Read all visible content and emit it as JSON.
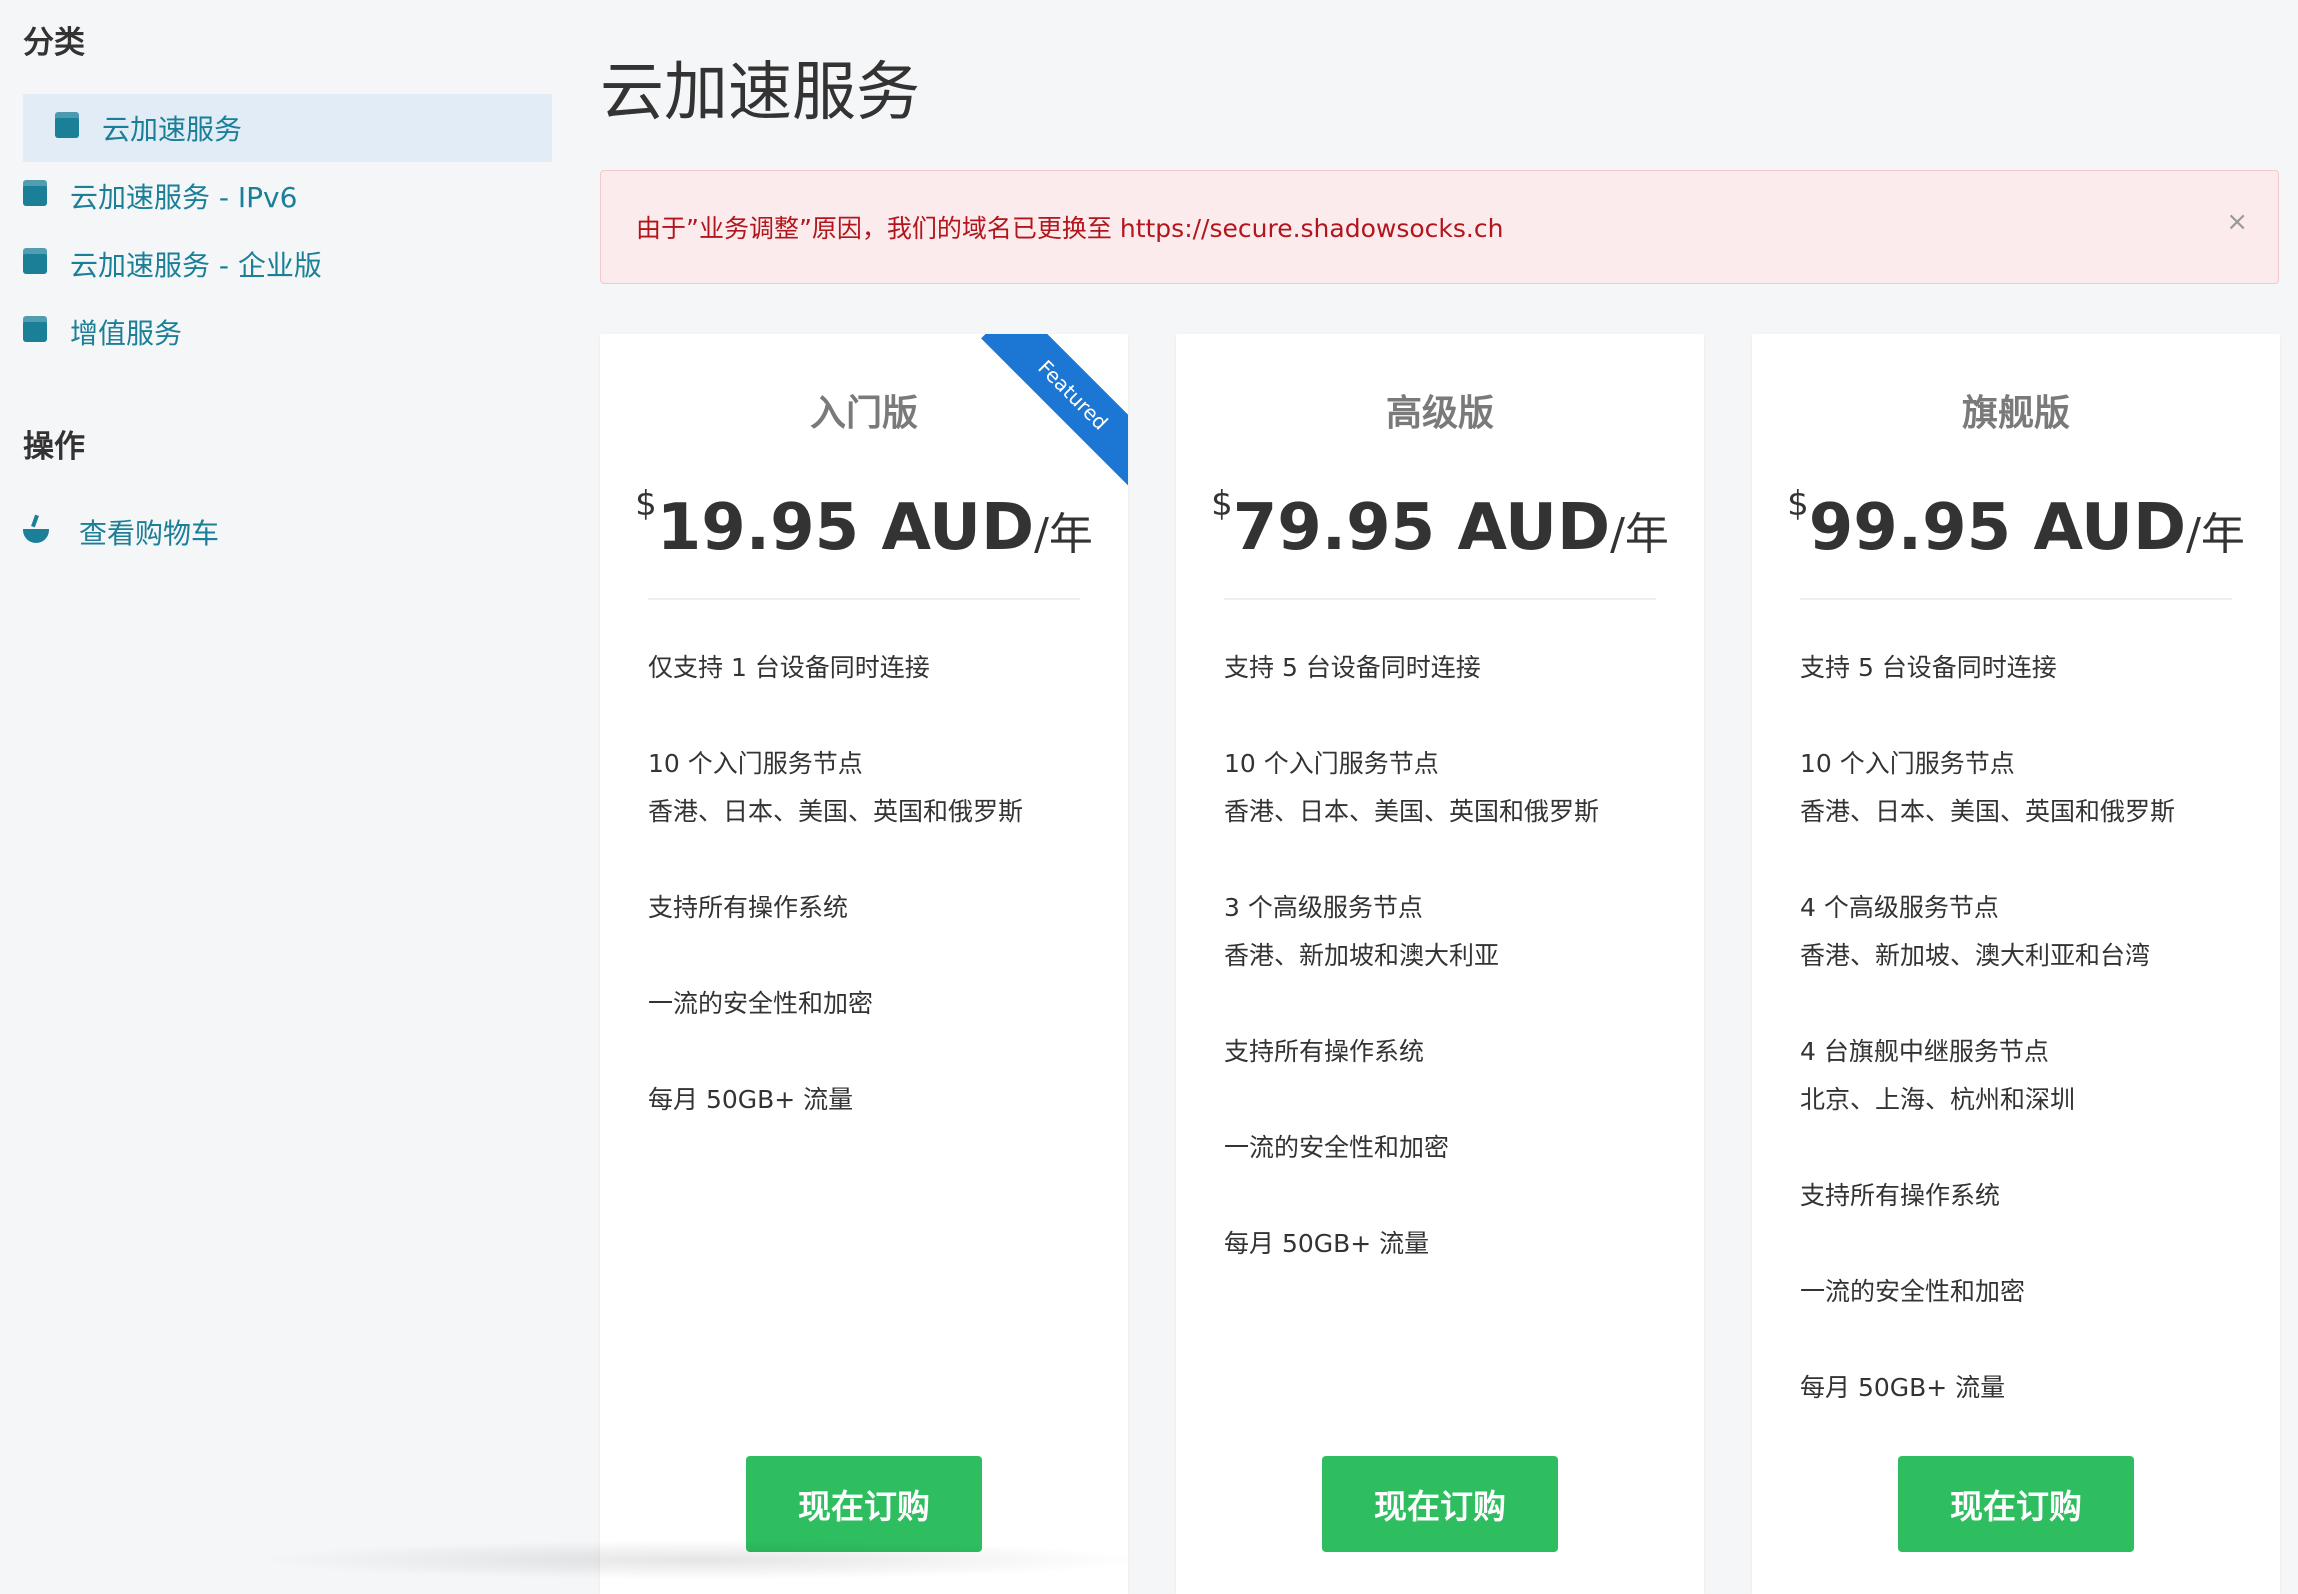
{
  "sidebar": {
    "categories_heading": "分类",
    "categories": [
      {
        "label": "云加速服务",
        "active": true
      },
      {
        "label": "云加速服务 - IPv6",
        "active": false
      },
      {
        "label": "云加速服务 - 企业版",
        "active": false
      },
      {
        "label": "增值服务",
        "active": false
      }
    ],
    "actions_heading": "操作",
    "actions": [
      {
        "label": "查看购物车",
        "icon": "basket-icon"
      }
    ]
  },
  "page": {
    "title": "云加速服务"
  },
  "alert": {
    "message": "由于”业务调整”原因，我们的域名已更换至 https://secure.shadowsocks.ch",
    "close": "×"
  },
  "plans": [
    {
      "name": "入门版",
      "currency_symbol": "$",
      "amount": "19.95 AUD",
      "unit": "/年",
      "ribbon": "Featured",
      "features": [
        [
          "仅支持 1 台设备同时连接"
        ],
        [
          "10 个入门服务节点",
          "香港、日本、美国、英国和俄罗斯"
        ],
        [
          "支持所有操作系统"
        ],
        [
          "一流的安全性和加密"
        ],
        [
          "每月 50GB+ 流量"
        ]
      ],
      "button": "现在订购"
    },
    {
      "name": "高级版",
      "currency_symbol": "$",
      "amount": "79.95 AUD",
      "unit": "/年",
      "features": [
        [
          "支持 5 台设备同时连接"
        ],
        [
          "10 个入门服务节点",
          "香港、日本、美国、英国和俄罗斯"
        ],
        [
          "3 个高级服务节点",
          "香港、新加坡和澳大利亚"
        ],
        [
          "支持所有操作系统"
        ],
        [
          "一流的安全性和加密"
        ],
        [
          "每月 50GB+ 流量"
        ]
      ],
      "button": "现在订购"
    },
    {
      "name": "旗舰版",
      "currency_symbol": "$",
      "amount": "99.95 AUD",
      "unit": "/年",
      "features": [
        [
          "支持 5 台设备同时连接"
        ],
        [
          "10 个入门服务节点",
          "香港、日本、美国、英国和俄罗斯"
        ],
        [
          "4 个高级服务节点",
          "香港、新加坡、澳大利亚和台湾"
        ],
        [
          "4 台旗舰中继服务节点",
          "北京、上海、杭州和深圳"
        ],
        [
          "支持所有操作系统"
        ],
        [
          "一流的安全性和加密"
        ],
        [
          "每月 50GB+ 流量"
        ]
      ],
      "button": "现在订购"
    }
  ],
  "colors": {
    "accent": "#1b7f98",
    "active_bg": "#e1ecf6",
    "alert_bg": "#fcebec",
    "alert_text": "#b2161d",
    "button": "#2ebd5f",
    "ribbon": "#1c77d4"
  }
}
